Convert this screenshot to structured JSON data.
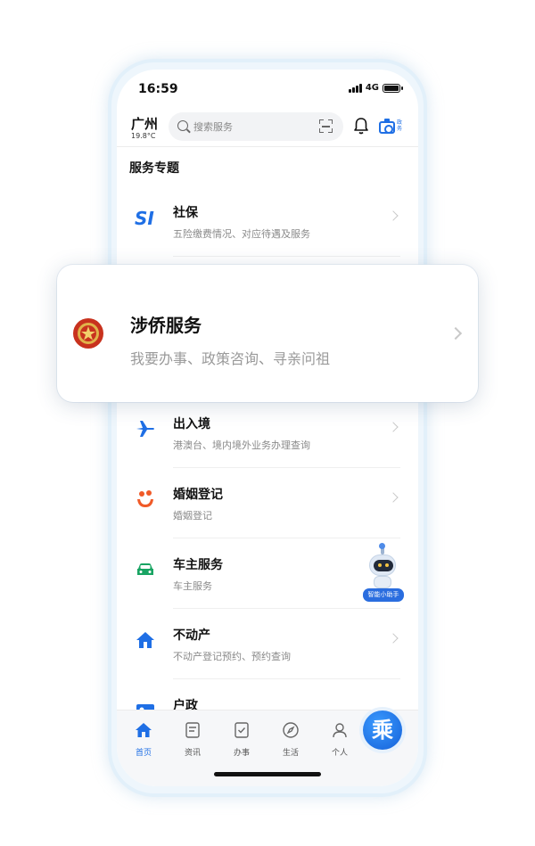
{
  "status_bar": {
    "time": "16:59",
    "network": "4G"
  },
  "header": {
    "city": "广州",
    "temperature": "19.8°C",
    "search_placeholder": "搜索服务",
    "camera_label": "政务"
  },
  "section": {
    "title": "服务专题"
  },
  "services": [
    {
      "title": "社保",
      "subtitle": "五险缴费情况、对应待遇及服务",
      "icon": "si-logo-icon"
    },
    {
      "title": "出入境",
      "subtitle": "港澳台、境内境外业务办理查询",
      "icon": "airplane-icon"
    },
    {
      "title": "婚姻登记",
      "subtitle": "婚姻登记",
      "icon": "marriage-icon"
    },
    {
      "title": "车主服务",
      "subtitle": "车主服务",
      "icon": "car-icon"
    },
    {
      "title": "不动产",
      "subtitle": "不动产登记预约、预约查询",
      "icon": "house-icon"
    },
    {
      "title": "户政",
      "subtitle": "",
      "icon": "id-card-icon"
    }
  ],
  "popup": {
    "title": "涉侨服务",
    "subtitle": "我要办事、政策咨询、寻亲问祖",
    "icon": "overseas-chinese-emblem-icon"
  },
  "assistant": {
    "label": "智能小助手"
  },
  "bottom_nav": [
    {
      "label": "首页",
      "icon": "home-icon",
      "active": true
    },
    {
      "label": "资讯",
      "icon": "news-icon",
      "active": false
    },
    {
      "label": "办事",
      "icon": "task-icon",
      "active": false
    },
    {
      "label": "生活",
      "icon": "compass-icon",
      "active": false
    },
    {
      "label": "个人",
      "icon": "person-icon",
      "active": false
    }
  ],
  "fab": {
    "label": "乘"
  },
  "colors": {
    "accent": "#1f6fe5",
    "marriage": "#f05a28",
    "car": "#19a463",
    "emblem": "#c8321e"
  }
}
